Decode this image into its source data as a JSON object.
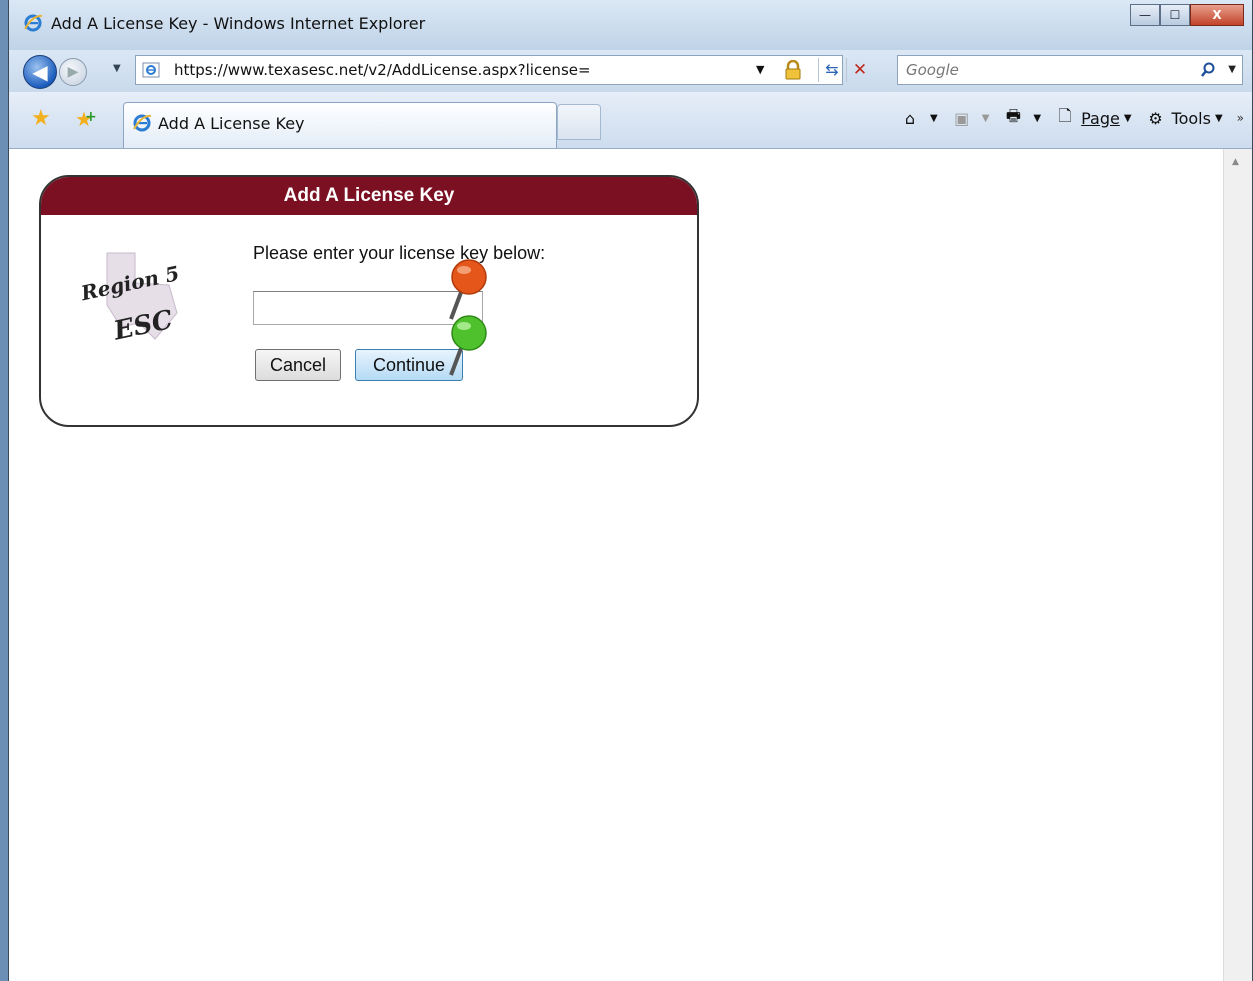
{
  "window": {
    "title": "Add A License Key - Windows Internet Explorer",
    "minimize_glyph": "—",
    "maximize_glyph": "☐",
    "close_glyph": "X"
  },
  "navbar": {
    "back_glyph": "◀",
    "forward_glyph": "▶",
    "address": "https://www.texasesc.net/v2/AddLicense.aspx?license=",
    "search_placeholder": "Google"
  },
  "tabbar": {
    "tab_label": "Add A License Key",
    "commands": {
      "page_label": "Page",
      "tools_label": "Tools"
    }
  },
  "page": {
    "panel_title": "Add A License Key",
    "logo_text_top": "Region 5",
    "logo_text_bottom": "ESC",
    "prompt": "Please enter your license key below:",
    "license_value": "",
    "cancel_label": "Cancel",
    "continue_label": "Continue"
  },
  "colors": {
    "header_maroon": "#7a1022",
    "pin_orange": "#e5561a",
    "pin_green": "#4fc12d"
  },
  "icons": [
    "ie-icon",
    "back-icon",
    "forward-icon",
    "lock-icon",
    "refresh-icon",
    "stop-icon",
    "search-icon",
    "favorites-star-icon",
    "add-favorites-icon",
    "home-icon",
    "feeds-icon",
    "print-icon",
    "page-icon",
    "tools-gear-icon",
    "pin-icon"
  ]
}
